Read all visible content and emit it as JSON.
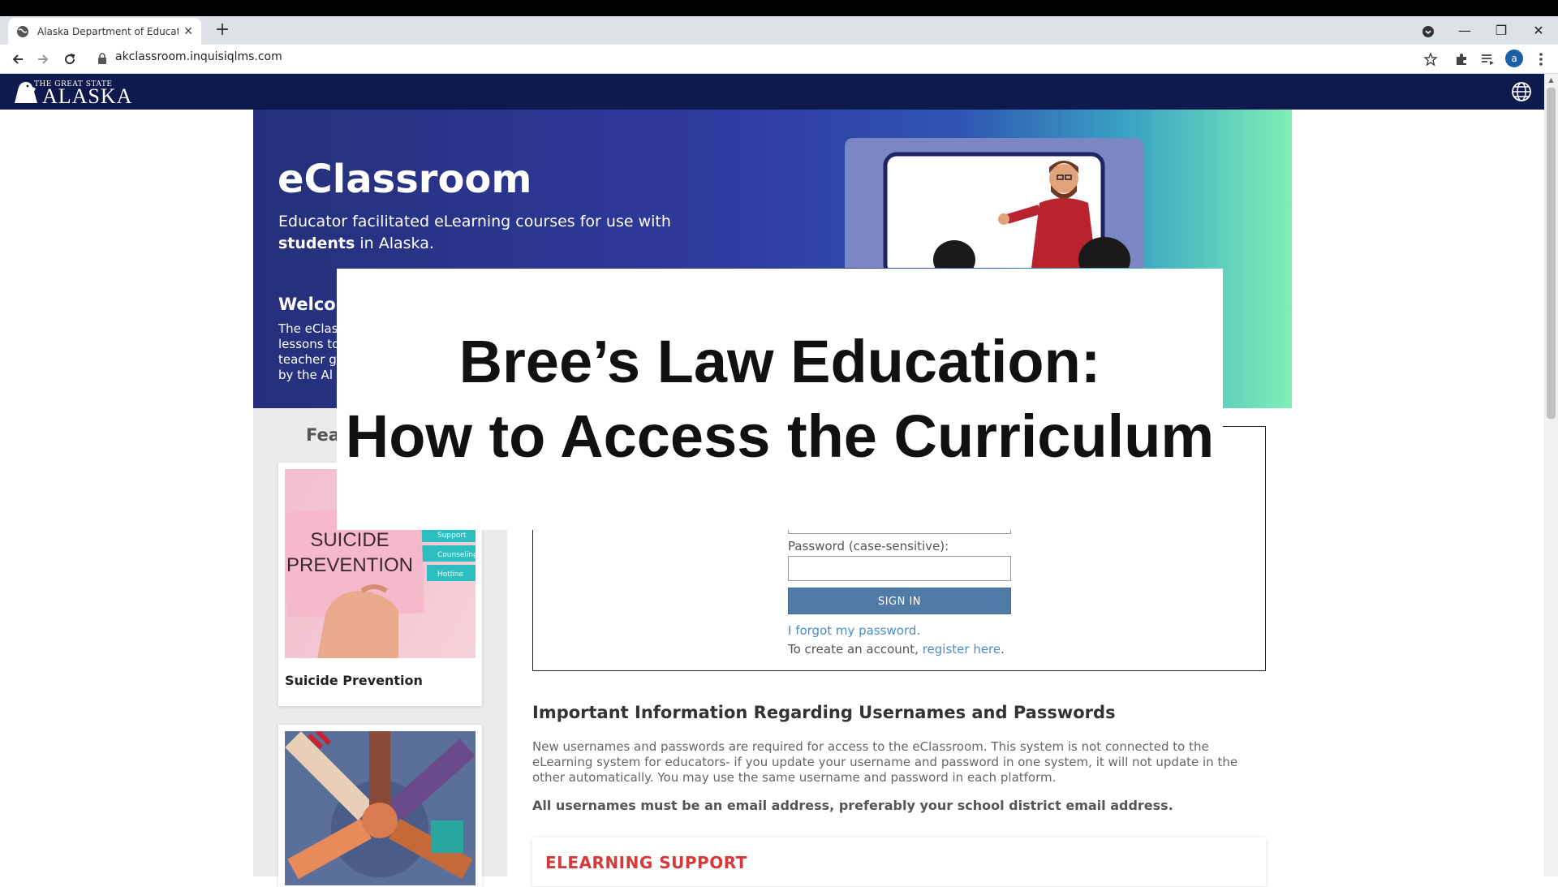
{
  "browser": {
    "tab_title": "Alaska Department of Education",
    "url": "akclassroom.inquisiqlms.com",
    "avatar_letter": "a"
  },
  "site": {
    "logo_small": "THE GREAT STATE",
    "logo_big": "ALASKA"
  },
  "hero": {
    "title": "eClassroom",
    "subtitle_line1": "Educator facilitated eLearning courses for use with",
    "subtitle_bold": "students",
    "subtitle_rest": " in Alaska.",
    "welcome_heading": "Welcome",
    "welcome_lines": [
      "The eClassroom",
      "lessons to",
      "teacher g",
      "by the Al"
    ]
  },
  "sidebar": {
    "featured_label": "Featured",
    "cards": [
      {
        "image_text": [
          "SUICIDE",
          "PREVENTION"
        ],
        "tags": [
          "Support",
          "Counseling",
          "Hotline"
        ],
        "caption": "Suicide Prevention"
      },
      {
        "caption": ""
      }
    ]
  },
  "login": {
    "password_label": "Password (case-sensitive):",
    "signin_label": "SIGN IN",
    "forgot_text": "I forgot my password.",
    "create_prefix": "To create an account, ",
    "create_link": "register here",
    "create_suffix": "."
  },
  "info": {
    "heading": "Important Information Regarding Usernames and Passwords",
    "lines": [
      "New usernames and passwords are required for access to the eClassroom. This system is not connected to the",
      "eLearning system for educators- if you update your username and password in one system, it will not update in the",
      "other automatically. You may use the same username and password in each platform."
    ],
    "bold_note": "All usernames must be an email address, preferably your school district email address."
  },
  "support": {
    "title": "ELEARNING SUPPORT"
  },
  "overlay": {
    "line1": "Bree’s Law Education:",
    "line2": "How to Access the Curriculum"
  },
  "colors": {
    "header_navy": "#0e1a4e",
    "signin_blue": "#4f7ba6",
    "link_blue": "#4a8ec5",
    "support_red": "#d43a3a"
  }
}
